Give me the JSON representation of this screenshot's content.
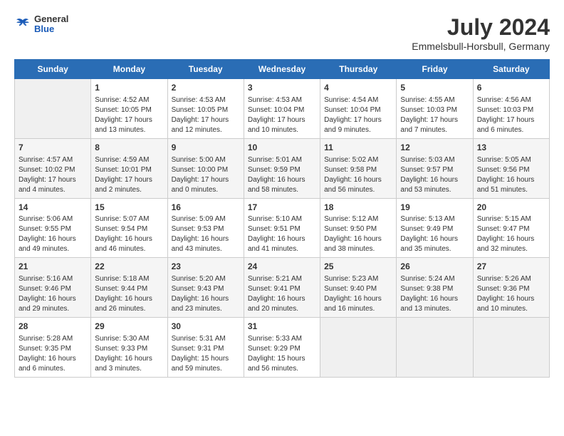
{
  "header": {
    "logo_general": "General",
    "logo_blue": "Blue",
    "month_year": "July 2024",
    "location": "Emmelsbull-Horsbull, Germany"
  },
  "weekdays": [
    "Sunday",
    "Monday",
    "Tuesday",
    "Wednesday",
    "Thursday",
    "Friday",
    "Saturday"
  ],
  "weeks": [
    [
      {
        "day": "",
        "info": ""
      },
      {
        "day": "1",
        "info": "Sunrise: 4:52 AM\nSunset: 10:05 PM\nDaylight: 17 hours\nand 13 minutes."
      },
      {
        "day": "2",
        "info": "Sunrise: 4:53 AM\nSunset: 10:05 PM\nDaylight: 17 hours\nand 12 minutes."
      },
      {
        "day": "3",
        "info": "Sunrise: 4:53 AM\nSunset: 10:04 PM\nDaylight: 17 hours\nand 10 minutes."
      },
      {
        "day": "4",
        "info": "Sunrise: 4:54 AM\nSunset: 10:04 PM\nDaylight: 17 hours\nand 9 minutes."
      },
      {
        "day": "5",
        "info": "Sunrise: 4:55 AM\nSunset: 10:03 PM\nDaylight: 17 hours\nand 7 minutes."
      },
      {
        "day": "6",
        "info": "Sunrise: 4:56 AM\nSunset: 10:03 PM\nDaylight: 17 hours\nand 6 minutes."
      }
    ],
    [
      {
        "day": "7",
        "info": "Sunrise: 4:57 AM\nSunset: 10:02 PM\nDaylight: 17 hours\nand 4 minutes."
      },
      {
        "day": "8",
        "info": "Sunrise: 4:59 AM\nSunset: 10:01 PM\nDaylight: 17 hours\nand 2 minutes."
      },
      {
        "day": "9",
        "info": "Sunrise: 5:00 AM\nSunset: 10:00 PM\nDaylight: 17 hours\nand 0 minutes."
      },
      {
        "day": "10",
        "info": "Sunrise: 5:01 AM\nSunset: 9:59 PM\nDaylight: 16 hours\nand 58 minutes."
      },
      {
        "day": "11",
        "info": "Sunrise: 5:02 AM\nSunset: 9:58 PM\nDaylight: 16 hours\nand 56 minutes."
      },
      {
        "day": "12",
        "info": "Sunrise: 5:03 AM\nSunset: 9:57 PM\nDaylight: 16 hours\nand 53 minutes."
      },
      {
        "day": "13",
        "info": "Sunrise: 5:05 AM\nSunset: 9:56 PM\nDaylight: 16 hours\nand 51 minutes."
      }
    ],
    [
      {
        "day": "14",
        "info": "Sunrise: 5:06 AM\nSunset: 9:55 PM\nDaylight: 16 hours\nand 49 minutes."
      },
      {
        "day": "15",
        "info": "Sunrise: 5:07 AM\nSunset: 9:54 PM\nDaylight: 16 hours\nand 46 minutes."
      },
      {
        "day": "16",
        "info": "Sunrise: 5:09 AM\nSunset: 9:53 PM\nDaylight: 16 hours\nand 43 minutes."
      },
      {
        "day": "17",
        "info": "Sunrise: 5:10 AM\nSunset: 9:51 PM\nDaylight: 16 hours\nand 41 minutes."
      },
      {
        "day": "18",
        "info": "Sunrise: 5:12 AM\nSunset: 9:50 PM\nDaylight: 16 hours\nand 38 minutes."
      },
      {
        "day": "19",
        "info": "Sunrise: 5:13 AM\nSunset: 9:49 PM\nDaylight: 16 hours\nand 35 minutes."
      },
      {
        "day": "20",
        "info": "Sunrise: 5:15 AM\nSunset: 9:47 PM\nDaylight: 16 hours\nand 32 minutes."
      }
    ],
    [
      {
        "day": "21",
        "info": "Sunrise: 5:16 AM\nSunset: 9:46 PM\nDaylight: 16 hours\nand 29 minutes."
      },
      {
        "day": "22",
        "info": "Sunrise: 5:18 AM\nSunset: 9:44 PM\nDaylight: 16 hours\nand 26 minutes."
      },
      {
        "day": "23",
        "info": "Sunrise: 5:20 AM\nSunset: 9:43 PM\nDaylight: 16 hours\nand 23 minutes."
      },
      {
        "day": "24",
        "info": "Sunrise: 5:21 AM\nSunset: 9:41 PM\nDaylight: 16 hours\nand 20 minutes."
      },
      {
        "day": "25",
        "info": "Sunrise: 5:23 AM\nSunset: 9:40 PM\nDaylight: 16 hours\nand 16 minutes."
      },
      {
        "day": "26",
        "info": "Sunrise: 5:24 AM\nSunset: 9:38 PM\nDaylight: 16 hours\nand 13 minutes."
      },
      {
        "day": "27",
        "info": "Sunrise: 5:26 AM\nSunset: 9:36 PM\nDaylight: 16 hours\nand 10 minutes."
      }
    ],
    [
      {
        "day": "28",
        "info": "Sunrise: 5:28 AM\nSunset: 9:35 PM\nDaylight: 16 hours\nand 6 minutes."
      },
      {
        "day": "29",
        "info": "Sunrise: 5:30 AM\nSunset: 9:33 PM\nDaylight: 16 hours\nand 3 minutes."
      },
      {
        "day": "30",
        "info": "Sunrise: 5:31 AM\nSunset: 9:31 PM\nDaylight: 15 hours\nand 59 minutes."
      },
      {
        "day": "31",
        "info": "Sunrise: 5:33 AM\nSunset: 9:29 PM\nDaylight: 15 hours\nand 56 minutes."
      },
      {
        "day": "",
        "info": ""
      },
      {
        "day": "",
        "info": ""
      },
      {
        "day": "",
        "info": ""
      }
    ]
  ]
}
